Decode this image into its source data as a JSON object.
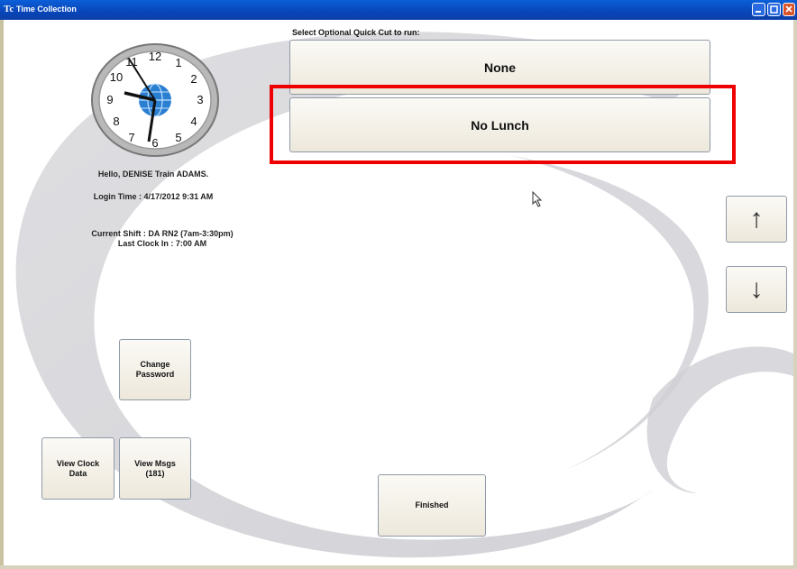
{
  "window": {
    "icon": "Tc",
    "title": "Time Collection"
  },
  "clock": {
    "numerals": [
      "12",
      "1",
      "2",
      "3",
      "4",
      "5",
      "6",
      "7",
      "8",
      "9",
      "10",
      "11"
    ]
  },
  "user": {
    "greeting": "Hello,  DENISE Train ADAMS.",
    "login_time": "Login Time : 4/17/2012 9:31 AM",
    "current_shift": "Current Shift : DA RN2 (7am-3:30pm)",
    "last_clock_in": "Last Clock In : 7:00 AM"
  },
  "quick_cut": {
    "label": "Select Optional Quick Cut to run:",
    "options": [
      "None",
      "No Lunch"
    ]
  },
  "buttons": {
    "change_password_line1": "Change",
    "change_password_line2": "Password",
    "view_clock_line1": "View Clock",
    "view_clock_line2": "Data",
    "view_msgs_line1": "View Msgs",
    "view_msgs_line2": "(181)",
    "finished": "Finished",
    "scroll_up": "↑",
    "scroll_down": "↓"
  },
  "icons": {
    "window_controls": [
      "minimize-icon",
      "maximize-icon",
      "close-icon"
    ],
    "cursor": "mouse-cursor-icon",
    "clock_center": "globe-icon"
  }
}
